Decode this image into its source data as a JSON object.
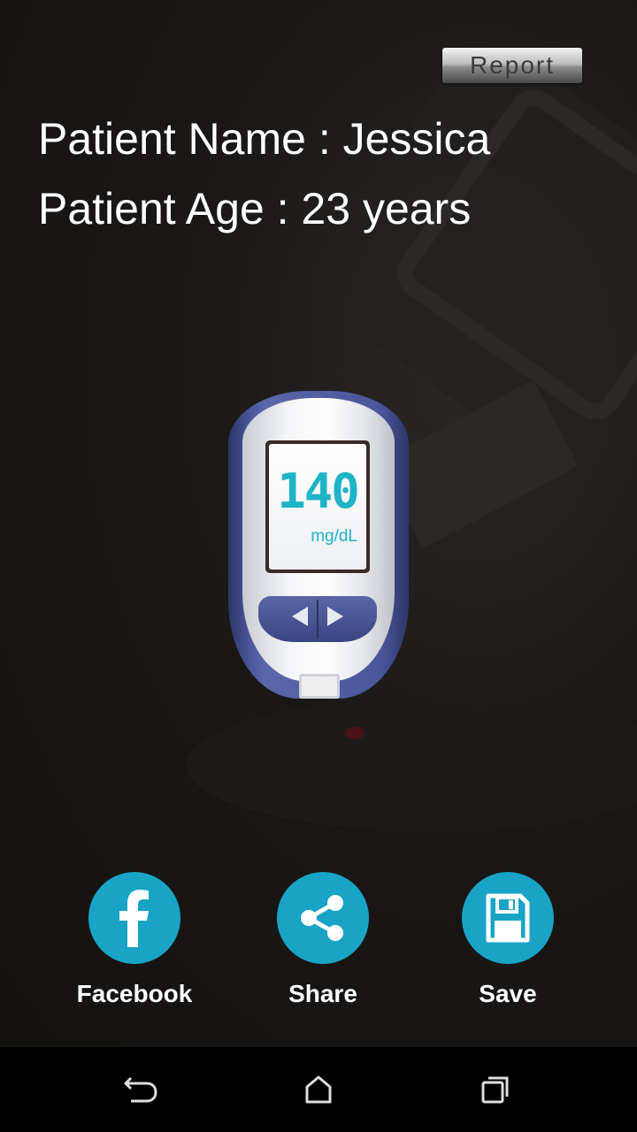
{
  "header": {
    "report_label": "Report"
  },
  "patient": {
    "name_line": "Patient Name : Jessica",
    "age_line": "Patient Age : 23 years"
  },
  "meter": {
    "reading": "140",
    "unit": "mg/dL"
  },
  "actions": [
    {
      "label": "Facebook",
      "icon": "facebook-icon"
    },
    {
      "label": "Share",
      "icon": "share-icon"
    },
    {
      "label": "Save",
      "icon": "save-icon"
    }
  ],
  "colors": {
    "accent": "#19a4c6",
    "lcd_digits": "#1fb3c8",
    "background": "#151311"
  },
  "navbar": {
    "icons": [
      "back-icon",
      "home-icon",
      "recent-apps-icon"
    ]
  }
}
